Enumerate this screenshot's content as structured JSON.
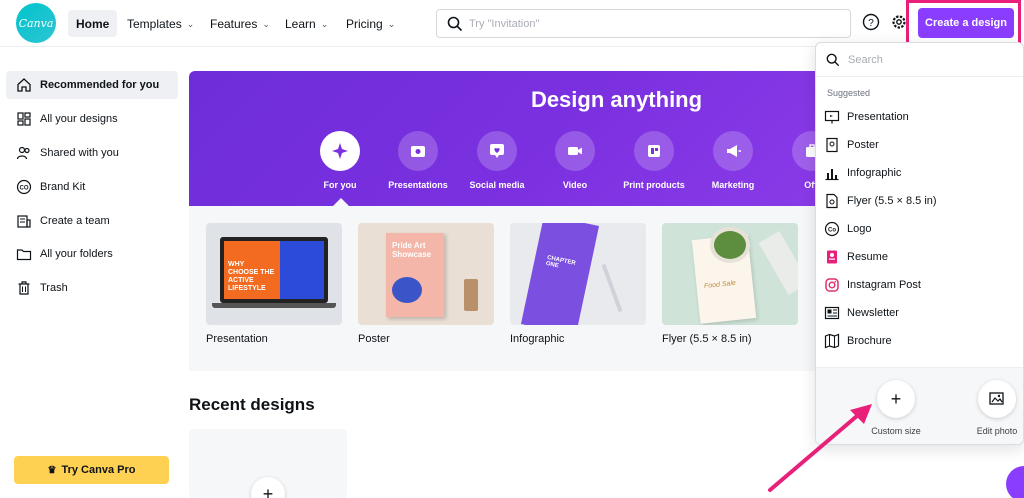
{
  "header": {
    "logo_text": "Canva",
    "nav": [
      {
        "label": "Home"
      },
      {
        "label": "Templates"
      },
      {
        "label": "Features"
      },
      {
        "label": "Learn"
      },
      {
        "label": "Pricing"
      }
    ],
    "search_placeholder": "Try \"Invitation\"",
    "create_button": "Create a design",
    "accent_color": "#8b3dff",
    "highlight_color": "#e8207a"
  },
  "sidebar": {
    "items": [
      {
        "label": "Recommended for you",
        "icon": "home-icon"
      },
      {
        "label": "All your designs",
        "icon": "grid-icon"
      },
      {
        "label": "Shared with you",
        "icon": "people-icon"
      },
      {
        "label": "Brand Kit",
        "icon": "brand-kit-icon"
      },
      {
        "label": "Create a team",
        "icon": "team-icon"
      },
      {
        "label": "All your folders",
        "icon": "folder-icon"
      },
      {
        "label": "Trash",
        "icon": "trash-icon"
      }
    ],
    "try_pro": "Try Canva Pro"
  },
  "hero": {
    "title": "Design anything",
    "categories": [
      {
        "label": "For you",
        "icon": "sparkle-icon"
      },
      {
        "label": "Presentations",
        "icon": "presentation-icon"
      },
      {
        "label": "Social media",
        "icon": "heart-chat-icon"
      },
      {
        "label": "Video",
        "icon": "video-icon"
      },
      {
        "label": "Print products",
        "icon": "print-icon"
      },
      {
        "label": "Marketing",
        "icon": "megaphone-icon"
      },
      {
        "label": "Offi",
        "icon": "office-icon"
      }
    ]
  },
  "templates": [
    {
      "label": "Presentation",
      "overlay": "WHY CHOOSE THE ACTIVE LIFESTYLE"
    },
    {
      "label": "Poster",
      "overlay": "Pride Art Showcase"
    },
    {
      "label": "Infographic",
      "overlay": "CHAPTER ONE"
    },
    {
      "label": "Flyer (5.5 × 8.5 in)",
      "overlay": "Food Sale"
    }
  ],
  "recent": {
    "title": "Recent designs",
    "plus": "+"
  },
  "dropdown": {
    "search_placeholder": "Search",
    "section": "Suggested",
    "items": [
      {
        "label": "Presentation",
        "icon": "presentation-icon"
      },
      {
        "label": "Poster",
        "icon": "poster-icon"
      },
      {
        "label": "Infographic",
        "icon": "bar-chart-icon"
      },
      {
        "label": "Flyer (5.5 × 8.5 in)",
        "icon": "flyer-icon"
      },
      {
        "label": "Logo",
        "icon": "logo-icon"
      },
      {
        "label": "Resume",
        "icon": "resume-icon"
      },
      {
        "label": "Instagram Post",
        "icon": "instagram-icon"
      },
      {
        "label": "Newsletter",
        "icon": "newsletter-icon"
      },
      {
        "label": "Brochure",
        "icon": "brochure-icon"
      }
    ],
    "actions": [
      {
        "label": "Custom size",
        "symbol": "+"
      },
      {
        "label": "Edit photo",
        "symbol": "image-edit-icon"
      }
    ]
  }
}
